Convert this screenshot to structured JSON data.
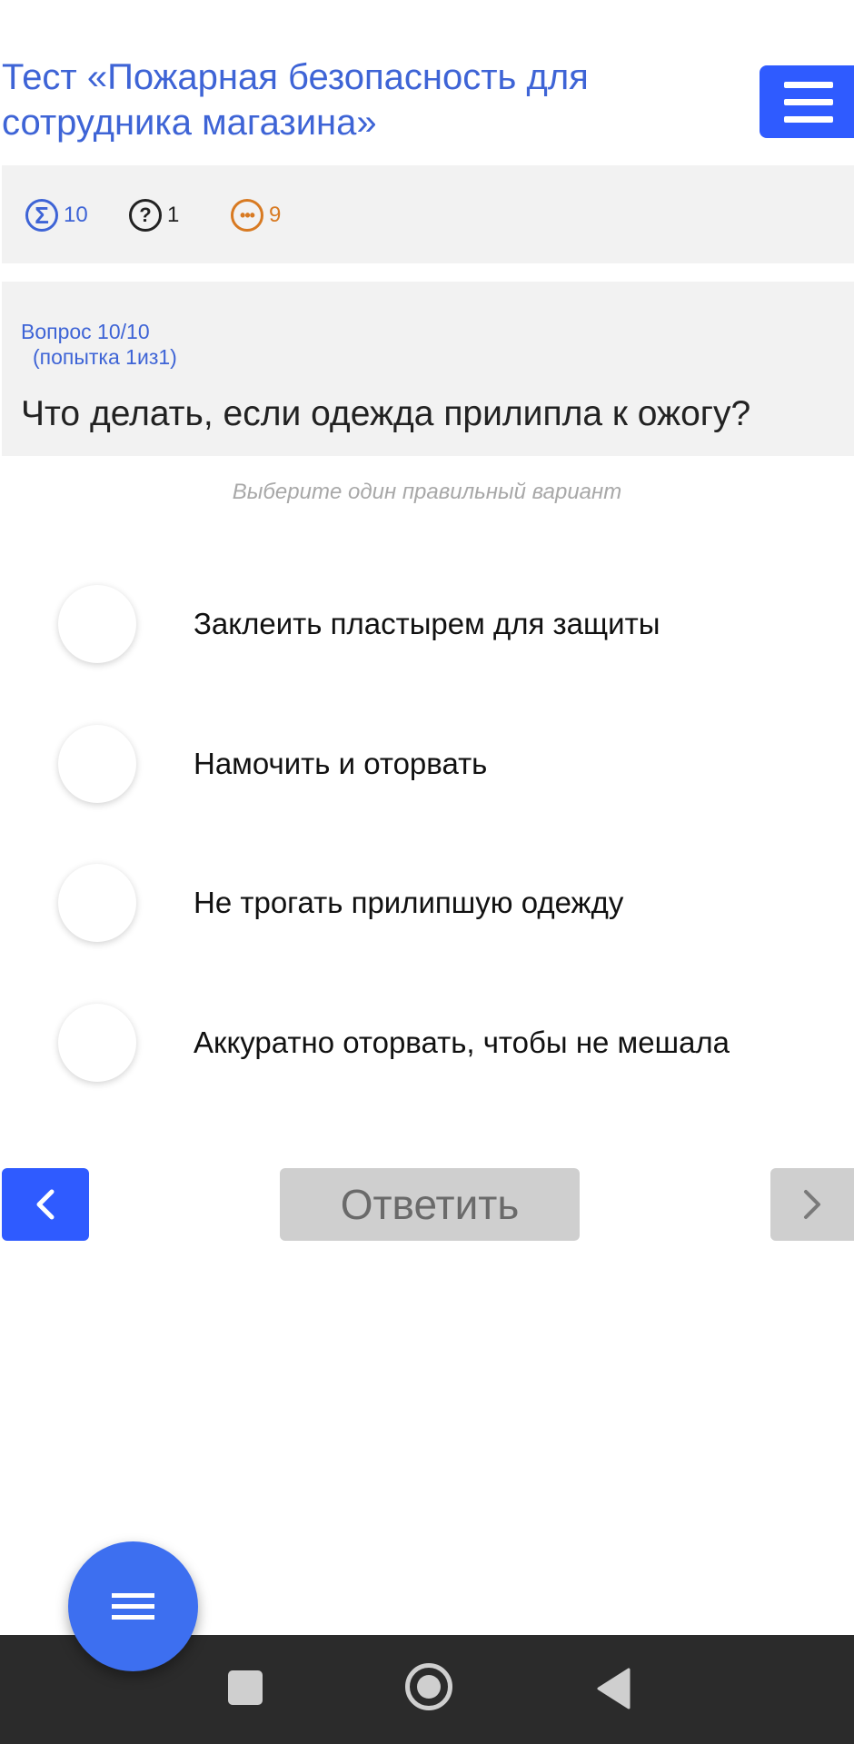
{
  "header": {
    "title": " Тест «Пожарная безопасность для сотрудника магазина»"
  },
  "stats": {
    "total": {
      "icon": "sigma-icon",
      "symbol": "Σ",
      "value": "10",
      "color": "#3e64d6"
    },
    "unanswered": {
      "icon": "question-icon",
      "symbol": "?",
      "value": "1",
      "color": "#222222"
    },
    "remaining": {
      "icon": "ellipsis-icon",
      "symbol": "•••",
      "value": "9",
      "color": "#d87a22"
    }
  },
  "question": {
    "counter": "Вопрос 10/10",
    "attempt": "(попытка 1из1)",
    "text": "Что делать, если одежда прилипла к ожогу?",
    "hint": "Выберите один правильный вариант"
  },
  "options": [
    {
      "label": "Заклеить пластырем для защиты"
    },
    {
      "label": "Намочить и оторвать"
    },
    {
      "label": "Не трогать прилипшую одежду"
    },
    {
      "label": "Аккуратно оторвать, чтобы не мешала"
    }
  ],
  "navigation": {
    "prev_icon": "chevron-left-icon",
    "submit_label": "Ответить",
    "next_icon": "chevron-right-icon"
  },
  "colors": {
    "accent": "#2f5bff",
    "title": "#3e64d6",
    "panel": "#f2f2f2",
    "disabled": "#cfcfcf"
  }
}
